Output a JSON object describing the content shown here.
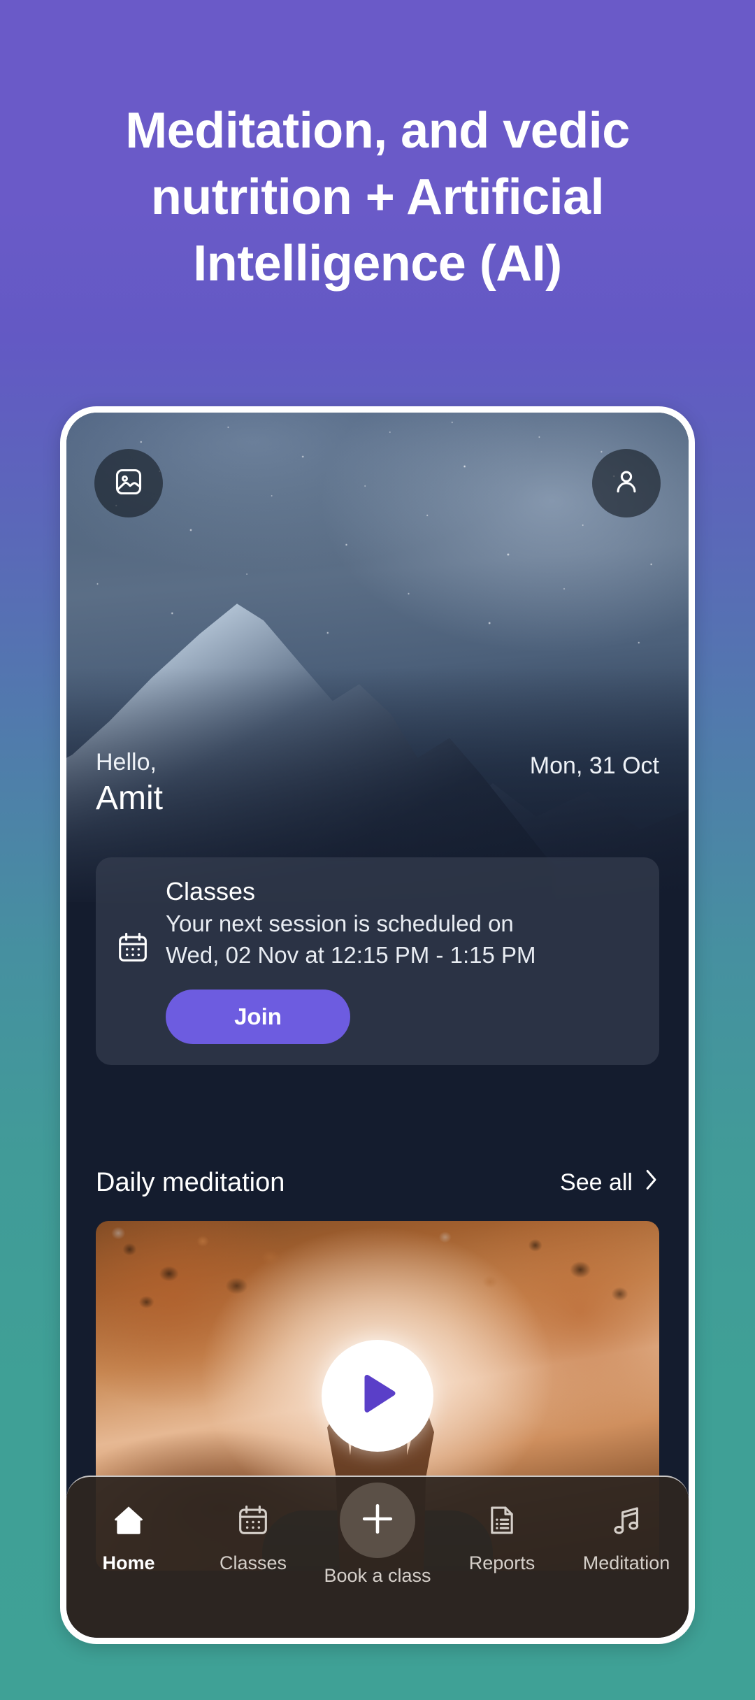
{
  "promo": {
    "headline": "Meditation, and vedic nutrition + Artificial Intelligence (AI)"
  },
  "colors": {
    "bg_top": "#6a5ac8",
    "bg_bottom": "#3fa096",
    "accent_purple": "#6d5ce0",
    "play_triangle": "#5a3fc8",
    "app_bg": "#141c2e",
    "nav_bg": "#2e2620"
  },
  "app": {
    "header": {
      "gallery_icon": "image-icon",
      "profile_icon": "person-icon"
    },
    "greeting": {
      "hello": "Hello,",
      "name": "Amit",
      "date": "Mon, 31 Oct"
    },
    "classes_card": {
      "icon": "calendar-icon",
      "title": "Classes",
      "line1": "Your next session is scheduled on",
      "line2": "Wed, 02 Nov at 12:15 PM - 1:15 PM",
      "button_label": "Join"
    },
    "section": {
      "title": "Daily meditation",
      "see_all_label": "See all",
      "see_all_icon": "chevron-right-icon"
    },
    "video_card": {
      "play_icon": "play-icon"
    },
    "bottom_nav": [
      {
        "label": "Home",
        "icon": "home-icon",
        "active": true
      },
      {
        "label": "Classes",
        "icon": "calendar-icon",
        "active": false
      },
      {
        "label": "Book a class",
        "icon": "plus-icon",
        "active": false
      },
      {
        "label": "Reports",
        "icon": "document-list-icon",
        "active": false
      },
      {
        "label": "Meditation",
        "icon": "music-note-icon",
        "active": false
      }
    ]
  }
}
